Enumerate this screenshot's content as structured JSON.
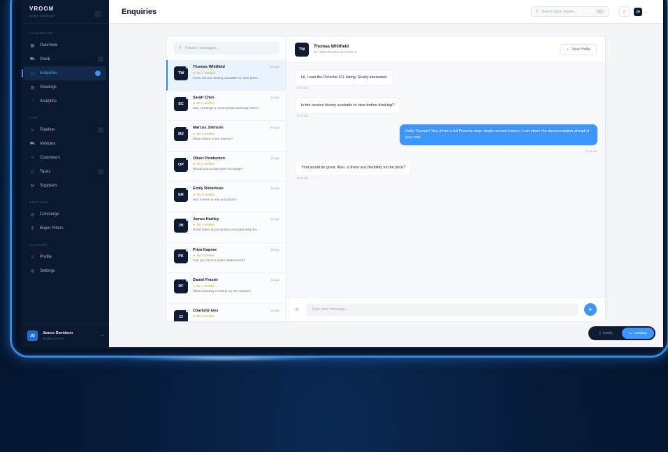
{
  "brand": {
    "name": "VROOM",
    "subtitle": "Dealer Dashboard"
  },
  "sidebar": {
    "sections": [
      {
        "title": "Dashboard",
        "items": [
          {
            "label": "Overview",
            "icon": "grid-icon"
          },
          {
            "label": "Stock",
            "icon": "car-icon"
          },
          {
            "label": "Enquiries",
            "icon": "chat-icon",
            "active": true
          },
          {
            "label": "Viewings",
            "icon": "calendar-icon"
          },
          {
            "label": "Analytics",
            "icon": "chart-icon"
          }
        ]
      },
      {
        "title": "CRM",
        "items": [
          {
            "label": "Pipeline",
            "icon": "pipeline-icon"
          },
          {
            "label": "Vehicles",
            "icon": "vehicle-icon"
          },
          {
            "label": "Customers",
            "icon": "users-icon"
          },
          {
            "label": "Tasks",
            "icon": "tasks-icon"
          },
          {
            "label": "Suppliers",
            "icon": "wrench-icon"
          }
        ]
      },
      {
        "title": "Services",
        "items": [
          {
            "label": "Concierge",
            "icon": "concierge-icon"
          },
          {
            "label": "Buyer Filters",
            "icon": "filter-icon"
          }
        ]
      },
      {
        "title": "Account",
        "items": [
          {
            "label": "Profile",
            "icon": "user-icon"
          },
          {
            "label": "Settings",
            "icon": "gear-icon"
          }
        ]
      }
    ],
    "user": {
      "initials": "JD",
      "name": "James Davidson",
      "role": "Dealer Account"
    }
  },
  "header": {
    "title": "Enquiries",
    "search_placeholder": "Search stock, buyers...",
    "search_shortcut": "⌘K",
    "user_initials": "JD"
  },
  "list": {
    "search_placeholder": "Search messages...",
    "conversations": [
      {
        "initials": "TW",
        "name": "Thomas Whitfield",
        "time": "1m ago",
        "tier": "★ Tier 1 Verified",
        "preview": "Is the service history available to view befor..."
      },
      {
        "initials": "SC",
        "name": "Sarah Chen",
        "time": "1h ago",
        "tier": "★ Tier 1 Verified",
        "preview": "Can I arrange a viewing this Saturday aftern..."
      },
      {
        "initials": "MJ",
        "name": "Marcus Johnson",
        "time": "4h ago",
        "tier": "★ Tier 2 Verified",
        "preview": "What colour is the interior?"
      },
      {
        "initials": "OP",
        "name": "Oliver Pemberton",
        "time": "1h ago",
        "tier": "★ Tier 1 Verified",
        "preview": "Would you accept part exchange?"
      },
      {
        "initials": "ER",
        "name": "Emily Robertson",
        "time": "1d ago",
        "tier": "★ Tier 2 Verified",
        "preview": "Has it been in any accidents?"
      },
      {
        "initials": "JH",
        "name": "James Hartley",
        "time": "1d ago",
        "tier": "★ Tier 1 Verified",
        "preview": "Is the Naim audio system included with this ..."
      },
      {
        "initials": "PK",
        "name": "Priya Kapoor",
        "time": "1d ago",
        "tier": "★ Tier 2 Verified",
        "preview": "Can you send a video walkaround?"
      },
      {
        "initials": "DF",
        "name": "Daniel Frasier",
        "time": "2d ago",
        "tier": "★ Tier 1 Verified",
        "preview": "What warranty remains on the vehicle?"
      },
      {
        "initials": "CI",
        "name": "Charlotte Ives",
        "time": "2d ago",
        "tier": "★ Tier 1 Verified",
        "preview": ""
      }
    ]
  },
  "chat": {
    "initials": "TW",
    "name": "Thomas Whitfield",
    "regarding": "Re: 2022 Porsche 911 Turbo S",
    "view_profile": "View Profile",
    "messages": [
      {
        "dir": "in",
        "text": "Hi, I saw the Porsche 911 listing. Really interested.",
        "time": "10:20 AM"
      },
      {
        "dir": "in",
        "text": "Is the service history available to view before booking?",
        "time": "10:22 AM"
      },
      {
        "dir": "out",
        "text": "Hello Thomas! Yes, it has a full Porsche main dealer service history. I can share the documentation ahead of your visit.",
        "time": "10:45 AM"
      },
      {
        "dir": "in",
        "text": "That would be great. Also, is there any flexibility on the price?",
        "time": "10:51 AM"
      }
    ],
    "input_placeholder": "Type your message..."
  },
  "view_toggle": {
    "mobile": "Mobile",
    "desktop": "Desktop",
    "selected": "Desktop"
  },
  "colors": {
    "accent": "#3d95ff",
    "sidebar": "#0b1930",
    "frame": "#2f8be6",
    "tier": "#d49b17"
  }
}
